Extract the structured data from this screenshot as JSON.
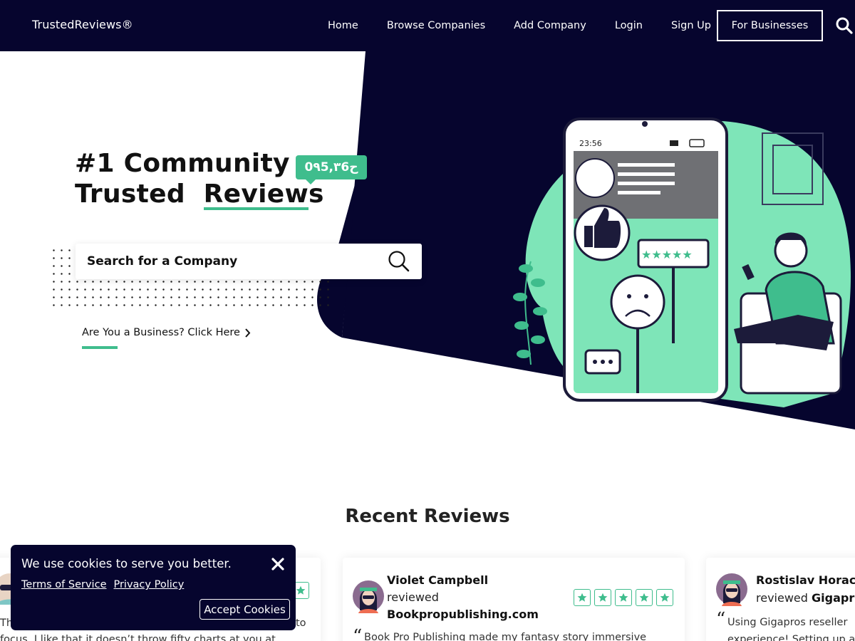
{
  "header": {
    "brand": "TrustedReviews®",
    "nav": [
      "Home",
      "Browse Companies",
      "Add Company",
      "Login",
      "Sign Up"
    ],
    "cta": "For Businesses"
  },
  "hero": {
    "headline_line1": "#1 Community",
    "headline_line2_prefix": "Trusted",
    "headline_line2_highlight": "Reviews",
    "counter": "0٩5,٣6ح",
    "search_placeholder": "Search for a Company",
    "business_link": "Are You a Business? Click Here",
    "phone_time": "23:56"
  },
  "recent": {
    "title": "Recent Reviews",
    "cards": [
      {
        "name": "",
        "reviewed": "",
        "company": "",
        "rating": 5,
        "quote": "focus. I like that it doesn’t throw fifty charts at you at",
        "quote_prefix_visible": "Th",
        "quote_tail_visible": "to"
      },
      {
        "name": "Violet Campbell",
        "reviewed": "reviewed",
        "company": "Bookpropublishing.com",
        "rating": 5,
        "quote": "Book Pro Publishing made my fantasy story immersive"
      },
      {
        "name": "Rostislav Horac",
        "reviewed": "reviewed",
        "company": "Gigapro",
        "rating": 5,
        "quote": "Using Gigapros reseller",
        "quote_line2": "experience! Setting up a"
      }
    ]
  },
  "cookie": {
    "message": "We use cookies to serve you better.",
    "terms": "Terms of Service",
    "privacy": "Privacy Policy",
    "accept": "Accept Cookies"
  },
  "colors": {
    "navy": "#06052e",
    "green": "#3fbd8d",
    "mint": "#7ee5b8"
  },
  "icons": [
    "search-icon",
    "chevron-right-icon",
    "star-icon",
    "close-icon",
    "avatar"
  ]
}
